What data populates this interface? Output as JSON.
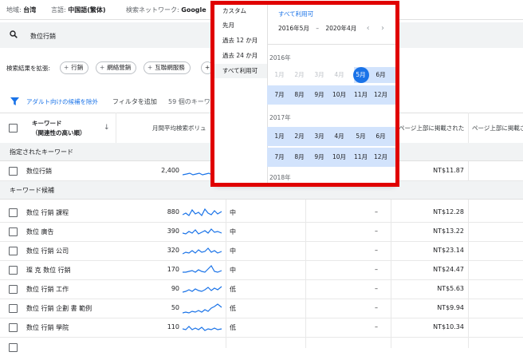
{
  "topbar": {
    "location_label": "地域:",
    "location_value": "台湾",
    "language_label": "言語:",
    "language_value": "中国語(繁体)",
    "network_label": "検索ネットワーク:",
    "network_value": "Google"
  },
  "search": {
    "value": "数位行銷"
  },
  "expand": {
    "label": "検索結果を拡張:",
    "chips": [
      "行銷",
      "網絡營銷",
      "互聯網服務",
      "+"
    ]
  },
  "filters": {
    "adult_exclude": "アダルト向けの候補を除外",
    "add_filter": "フィルタを追加",
    "count_prefix": "59 個のキーワ"
  },
  "table": {
    "header_keyword": "キーワード",
    "header_keyword_sort": "（関連性の高い順）",
    "header_volume": "月間平均検索ボリュ",
    "header_top_low": "ページ上部に掲載された(低",
    "header_top_high": "ページ上部に掲載さ",
    "section_specified": "指定されたキーワード",
    "section_candidates": "キーワード候補",
    "specified_rows": [
      {
        "keyword": "数位行銷",
        "volume": "2,400",
        "competition": "",
        "dash": "",
        "bid": "NT$11.87"
      }
    ],
    "rows": [
      {
        "keyword": "数位 行銷 課程",
        "volume": "880",
        "competition": "中",
        "dash": "–",
        "bid": "NT$12.28"
      },
      {
        "keyword": "数位 廣告",
        "volume": "390",
        "competition": "中",
        "dash": "–",
        "bid": "NT$13.22"
      },
      {
        "keyword": "数位 行銷 公司",
        "volume": "320",
        "competition": "中",
        "dash": "–",
        "bid": "NT$23.14"
      },
      {
        "keyword": "璨 克 数位 行銷",
        "volume": "170",
        "competition": "中",
        "dash": "–",
        "bid": "NT$24.47"
      },
      {
        "keyword": "数位 行銷 工作",
        "volume": "90",
        "competition": "低",
        "dash": "–",
        "bid": "NT$5.63"
      },
      {
        "keyword": "数位 行銷 企劃 書 範例",
        "volume": "50",
        "competition": "低",
        "dash": "–",
        "bid": "NT$9.94"
      },
      {
        "keyword": "数位 行銷 學院",
        "volume": "110",
        "competition": "低",
        "dash": "–",
        "bid": "NT$10.34"
      }
    ]
  },
  "date_popup": {
    "presets": [
      "カスタム",
      "先月",
      "過去 12 か月",
      "過去 24 か月",
      "すべて利用可"
    ],
    "selected_preset": "すべて利用可",
    "range_label": "すべて利用可",
    "start": "2016年5月",
    "separator": "–",
    "end": "2020年4月",
    "years": [
      "2016年",
      "2017年",
      "2018年"
    ],
    "months_row1": [
      "1月",
      "2月",
      "3月",
      "4月",
      "5月",
      "6月"
    ],
    "months_row2": [
      "7月",
      "8月",
      "9月",
      "10月",
      "11月",
      "12月"
    ]
  },
  "colors": {
    "accent": "#1a73e8",
    "highlight_box": "#e00000",
    "range_band": "#d2e3fc"
  }
}
